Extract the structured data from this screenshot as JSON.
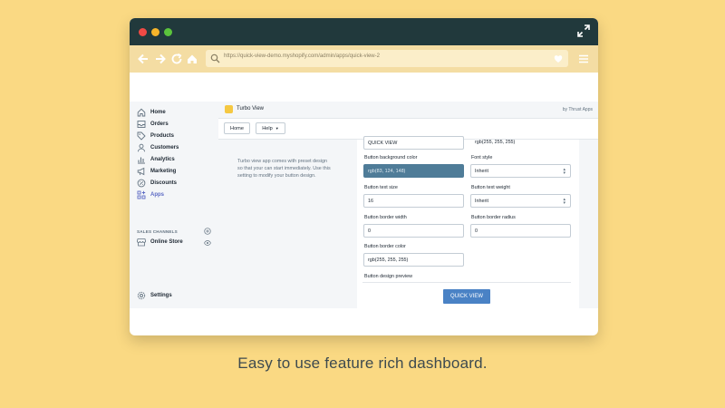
{
  "browser": {
    "url": "https://quick-view-demo.myshopify.com/admin/apps/quick-view-2"
  },
  "app": {
    "name": "Turbo View",
    "by": "by Thrust Apps"
  },
  "actions": {
    "home": "Home",
    "help": "Help"
  },
  "sidebar": {
    "items": [
      {
        "label": "Home",
        "icon": "home-icon"
      },
      {
        "label": "Orders",
        "icon": "orders-icon"
      },
      {
        "label": "Products",
        "icon": "tag-icon"
      },
      {
        "label": "Customers",
        "icon": "person-icon"
      },
      {
        "label": "Analytics",
        "icon": "bar-chart-icon"
      },
      {
        "label": "Marketing",
        "icon": "megaphone-icon"
      },
      {
        "label": "Discounts",
        "icon": "discount-icon"
      },
      {
        "label": "Apps",
        "icon": "apps-icon"
      }
    ],
    "section_title": "SALES CHANNELS",
    "online_store": "Online Store",
    "settings": "Settings"
  },
  "description": [
    "Turbo view app comes with preset design",
    "so that your can start immediately. Use this",
    "setting to modify your button design."
  ],
  "form": {
    "button_text_value": "QUICK VIEW",
    "top_right_value": "rgb(255, 255, 255)",
    "bg_color_label": "Button background color",
    "bg_color_value": "rgb(83, 124, 148)",
    "font_style_label": "Font style",
    "font_style_value": "Inherit",
    "text_size_label": "Button text size",
    "text_size_value": "16",
    "text_weight_label": "Button text weight",
    "text_weight_value": "Inherit",
    "border_width_label": "Button border width",
    "border_width_value": "0",
    "border_radius_label": "Button border radius",
    "border_radius_value": "0",
    "border_color_label": "Button border color",
    "border_color_value": "rgb(255, 255, 255)",
    "preview_label": "Button design preview",
    "preview_button": "QUICK VIEW"
  },
  "caption": "Easy to use feature rich dashboard.",
  "colors": {
    "background": "#fad983",
    "titlebar": "#21393c",
    "accent": "#5c6ac4",
    "preview_button": "#4a82c5",
    "filled_field": "#4f7c98"
  }
}
